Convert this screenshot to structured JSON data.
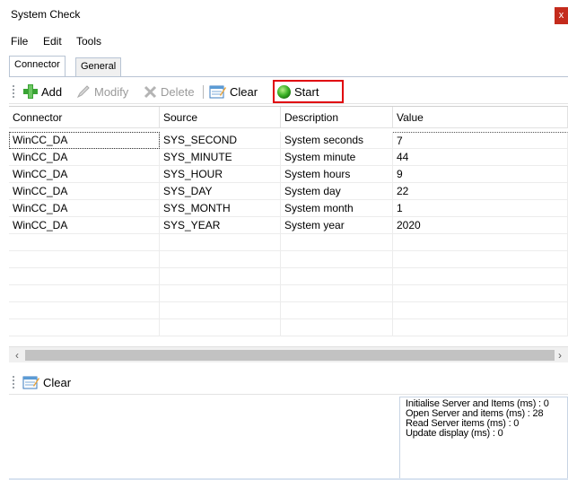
{
  "window": {
    "title": "System Check",
    "close_label": "x"
  },
  "menu": {
    "items": [
      "File",
      "Edit",
      "Tools"
    ]
  },
  "tabs": [
    {
      "label": "Connector",
      "active": true
    },
    {
      "label": "General",
      "active": false
    }
  ],
  "toolbar": {
    "add_label": "Add",
    "modify_label": "Modify",
    "delete_label": "Delete",
    "clear_label": "Clear",
    "start_label": "Start",
    "highlight_color": "#e0000b"
  },
  "grid": {
    "columns": [
      "Connector",
      "Source",
      "Description",
      "Value"
    ],
    "rows": [
      {
        "connector": "WinCC_DA",
        "source": "SYS_SECOND",
        "description": "System seconds",
        "value": "7"
      },
      {
        "connector": "WinCC_DA",
        "source": "SYS_MINUTE",
        "description": "System minute",
        "value": "44"
      },
      {
        "connector": "WinCC_DA",
        "source": "SYS_HOUR",
        "description": "System hours",
        "value": "9"
      },
      {
        "connector": "WinCC_DA",
        "source": "SYS_DAY",
        "description": "System day",
        "value": "22"
      },
      {
        "connector": "WinCC_DA",
        "source": "SYS_MONTH",
        "description": "System month",
        "value": "1"
      },
      {
        "connector": "WinCC_DA",
        "source": "SYS_YEAR",
        "description": "System year",
        "value": "2020"
      }
    ]
  },
  "log_toolbar": {
    "clear_label": "Clear"
  },
  "stats": [
    "Initialise Server and Items (ms) : 0",
    "Open Server and items (ms) : 28",
    "Read Server items (ms) : 0",
    "Update display (ms) : 0"
  ]
}
